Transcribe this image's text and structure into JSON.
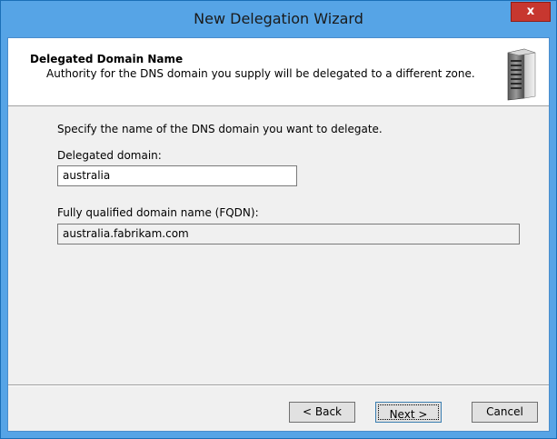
{
  "window": {
    "title": "New Delegation Wizard",
    "close_glyph": "x"
  },
  "header": {
    "title": "Delegated Domain Name",
    "subtitle": "Authority for the DNS domain you supply will be delegated to a different zone.",
    "icon": "server-icon"
  },
  "body": {
    "instruction": "Specify the name of the DNS domain you want to delegate.",
    "delegated_label": "Delegated domain:",
    "delegated_value": "australia",
    "fqdn_label": "Fully qualified domain name (FQDN):",
    "fqdn_value": "australia.fabrikam.com"
  },
  "buttons": {
    "back": "< Back",
    "next": "Next >",
    "cancel": "Cancel"
  },
  "colors": {
    "titlebar": "#56a4e6",
    "close_button": "#c7372f",
    "dialog_background": "#f0f0f0"
  }
}
